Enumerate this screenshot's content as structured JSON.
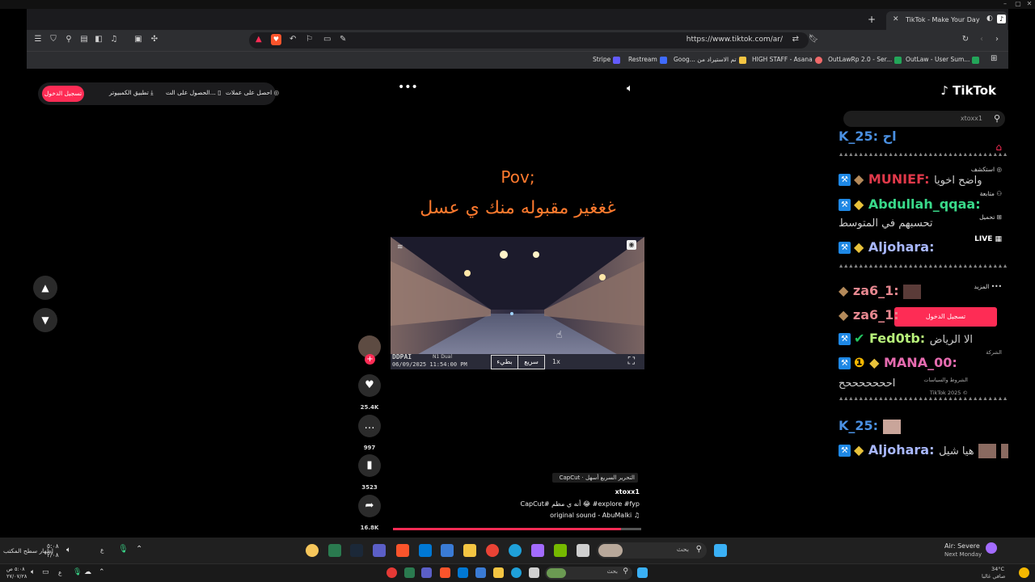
{
  "browser": {
    "tab_title": "TikTok - Make Your Day",
    "url": "https://www.tiktok.com/ar/",
    "bookmarks": [
      {
        "label": "Stripe",
        "color": "#635bff"
      },
      {
        "label": "Restream",
        "color": "#3f6bff"
      },
      {
        "label": "Goog... تم الاستيراد من",
        "color": "#f4c542"
      },
      {
        "label": "HIGH STAFF - Asana",
        "color": "#f06a6a"
      },
      {
        "label": "OutLawRp 2.0 - Ser...",
        "color": "#23a559"
      },
      {
        "label": "OutLaw - User Sum...",
        "color": "#23a559"
      }
    ]
  },
  "top_bar": {
    "login": "تسجيل الدخول",
    "desktop_app": "تطبيق الكمبيوتر",
    "get_app": "الحصول على الت...",
    "get_coins": "احصل على عملات"
  },
  "video": {
    "caption_line1": "Pov;",
    "caption_line2": "غغغير مقبوله منك ي عسل",
    "dashcam_brand": "DDPAI",
    "dashcam_model": "N1 Dual",
    "dashcam_time": "06/09/2025 11:54:00 PM",
    "btn_slow": "بطيء",
    "btn_fast": "سريع",
    "speed": "1x",
    "likes": "25.4K",
    "comments": "997",
    "saves": "3523",
    "shares": "16.8K",
    "capcut_tag": "CapCut · التحرير السريع أسهل",
    "author": "xtoxx1",
    "desc": "CapCut# أنه ي مطم 😂 #explore #fyp",
    "sound": "original sound - AbuMalki ♫",
    "progress": 0.92
  },
  "sidebar": {
    "logo": "TikTok",
    "search_value": "xtoxx1",
    "items": {
      "explore": "استكشف",
      "following": "متابعة",
      "upload": "تحميل",
      "live": "LIVE",
      "more": "المزيد",
      "login": "تسجيل الدخول",
      "company": "الشركة",
      "terms": "الشروط والسياسات",
      "copyright": "TikTok 2025 ©"
    }
  },
  "chat": {
    "top_fragment": "K_25: اح",
    "m1_user": "MUNIEF:",
    "m1_msg": "واضح اخويا",
    "m2_user": "Abdullah_qqaa:",
    "m2_msg": "تحسبهم في المتوسط",
    "m3_user": "Aljohara:",
    "m4_user": "za6_1:",
    "m5_user": "za6_1:",
    "m6_user": "Fed0tb:",
    "m6_msg": "الا الرياض",
    "m7_user": "MANA_00:",
    "m7_msg": "احححححححح",
    "m8_user": "K_25:",
    "m9_user": "Aljohara:",
    "m9_msg": "هيا شيل"
  },
  "taskbar": {
    "search_placeholder": "بحث",
    "weather_title": "Air: Severe",
    "weather_sub": "Next Monday",
    "time_top": "٥:٠٨",
    "date_top": "٢/٠٨",
    "show_desktop": "إظهار سطح المكتب",
    "lang": "ع",
    "temp": "34°C",
    "temp_sub": "صافي غالبا",
    "time_bottom": "٥:٠٨ ص",
    "date_bottom": "٢٧/٠٧/٢٨",
    "search_placeholder_2": "بحث"
  }
}
